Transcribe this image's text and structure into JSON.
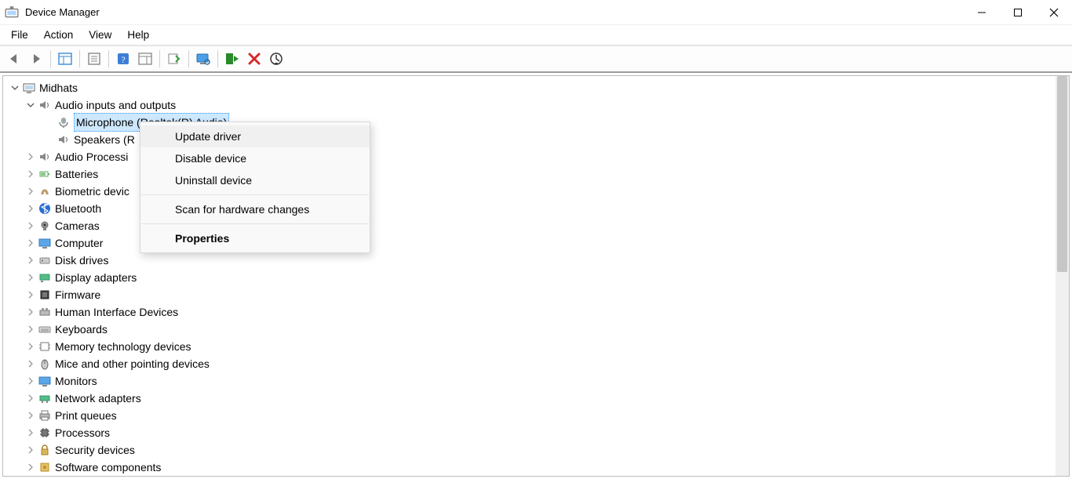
{
  "window": {
    "title": "Device Manager"
  },
  "menu": {
    "file": "File",
    "action": "Action",
    "view": "View",
    "help": "Help"
  },
  "tree": {
    "root": "Midhats",
    "audio_io": "Audio inputs and outputs",
    "microphone": "Microphone (Realtek(R) Audio)",
    "speakers": "Speakers (R",
    "audio_processing": "Audio Processi",
    "batteries": "Batteries",
    "biometric": "Biometric devic",
    "bluetooth": "Bluetooth",
    "cameras": "Cameras",
    "computer": "Computer",
    "disk_drives": "Disk drives",
    "display_adapters": "Display adapters",
    "firmware": "Firmware",
    "hid": "Human Interface Devices",
    "keyboards": "Keyboards",
    "memory_tech": "Memory technology devices",
    "mice": "Mice and other pointing devices",
    "monitors": "Monitors",
    "network": "Network adapters",
    "print_queues": "Print queues",
    "processors": "Processors",
    "security_devices": "Security devices",
    "software_components": "Software components"
  },
  "context_menu": {
    "update_driver": "Update driver",
    "disable_device": "Disable device",
    "uninstall_device": "Uninstall device",
    "scan_hardware": "Scan for hardware changes",
    "properties": "Properties"
  }
}
